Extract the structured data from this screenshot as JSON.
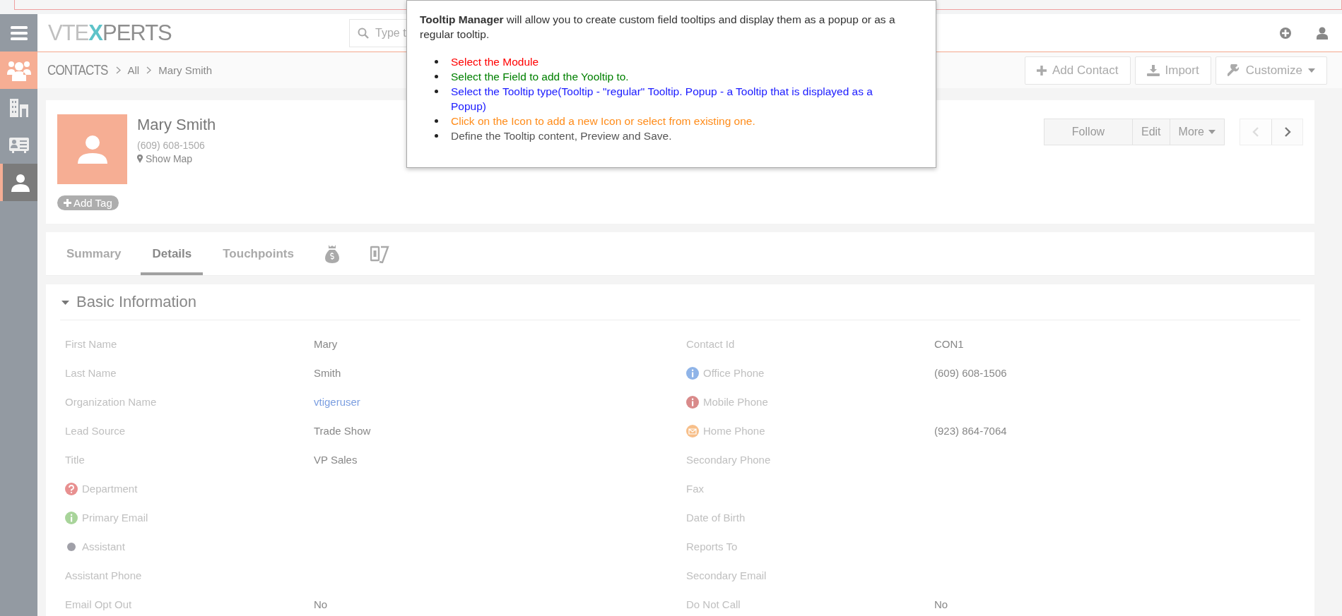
{
  "header": {
    "logo": "VTEXPERTS",
    "search": {
      "placeholder": "Type t"
    }
  },
  "sidebar": {
    "items": [
      {
        "kind": "menu",
        "accent": false,
        "selected": false
      },
      {
        "kind": "people",
        "accent": true,
        "selected": false
      },
      {
        "kind": "building",
        "accent": false,
        "selected": false
      },
      {
        "kind": "card",
        "accent": false,
        "selected": false
      },
      {
        "kind": "person",
        "accent": false,
        "selected": true
      }
    ]
  },
  "breadcrumb": [
    "CONTACTS",
    "All",
    "Mary Smith"
  ],
  "actions": [
    {
      "kind": "plus",
      "label": "Add Contact",
      "dropdown": false
    },
    {
      "kind": "download",
      "label": "Import",
      "dropdown": false
    },
    {
      "kind": "wrench",
      "label": "Customize",
      "dropdown": true
    }
  ],
  "record": {
    "name": "Mary Smith",
    "phone": "(609) 608-1506",
    "map_link": "Show Map",
    "tag_button": "Add Tag",
    "buttons": [
      {
        "label": "Follow",
        "dropdown": false
      },
      {
        "label": "Edit",
        "dropdown": false
      },
      {
        "label": "More",
        "dropdown": true
      }
    ],
    "pager": [
      {
        "kind": "prev",
        "disabled": true
      },
      {
        "kind": "next",
        "disabled": false
      }
    ]
  },
  "tabs": [
    {
      "label": "Summary",
      "selected": false
    },
    {
      "label": "Details",
      "selected": true
    },
    {
      "label": "Touchpoints",
      "selected": false
    },
    {
      "kind": "money-bag",
      "selected": false
    },
    {
      "kind": "tickets",
      "selected": false
    }
  ],
  "section": {
    "title": "Basic Information",
    "expanded": true,
    "rows": [
      {
        "left": {
          "label": "First Name",
          "value": "Mary"
        },
        "right": {
          "label": "Contact Id",
          "value": "CON1"
        }
      },
      {
        "left": {
          "label": "Last Name",
          "value": "Smith"
        },
        "right": {
          "label": "Office Phone",
          "kind": "info",
          "color": "#8fb4e8",
          "value": "(609) 608-1506"
        }
      },
      {
        "left": {
          "label": "Organization Name",
          "value": "vtigeruser",
          "link": true
        },
        "right": {
          "label": "Mobile Phone",
          "kind": "info",
          "color": "#d98a8a"
        }
      },
      {
        "left": {
          "label": "Lead Source",
          "value": "Trade Show"
        },
        "right": {
          "label": "Home Phone",
          "kind": "mail",
          "color": "#f7bf8a",
          "value": "(923) 864-7064"
        }
      },
      {
        "left": {
          "label": "Title",
          "value": "VP Sales"
        },
        "right": {
          "label": "Secondary Phone"
        }
      },
      {
        "left": {
          "label": "Department",
          "kind": "question",
          "color": "#e89090"
        },
        "right": {
          "label": "Fax"
        }
      },
      {
        "left": {
          "label": "Primary Email",
          "kind": "info",
          "color": "#a8d49a"
        },
        "right": {
          "label": "Date of Birth"
        }
      },
      {
        "left": {
          "label": "Assistant",
          "kind": "dot",
          "color": "#a0a0a8"
        },
        "right": {
          "label": "Reports To"
        }
      },
      {
        "left": {
          "label": "Assistant Phone"
        },
        "right": {
          "label": "Secondary Email"
        }
      },
      {
        "left": {
          "label": "Email Opt Out",
          "value": "No"
        },
        "right": {
          "label": "Do Not Call",
          "value": "No"
        }
      }
    ]
  },
  "tooltip": {
    "text": "**Tooltip Manager** will allow you to create custom field tooltips and display them as a popup or as a regular tooltip.",
    "steps": [
      {
        "text": "Select the Module",
        "color": "#ff0000"
      },
      {
        "text": "Select the Field to add the Yooltip to.",
        "color": "#008000"
      },
      {
        "text": "Select the Tooltip type(Tooltip - \"regular\" Tooltip. Popup - a Tooltip that is displayed as a Popup)",
        "color": "#1a1aff"
      },
      {
        "text": "Click on the Icon to add a new Icon or select from existing one.",
        "color": "#ff8c1a"
      },
      {
        "text": "Define the Tooltip content, Preview and Save.",
        "color": "#555555"
      }
    ]
  }
}
